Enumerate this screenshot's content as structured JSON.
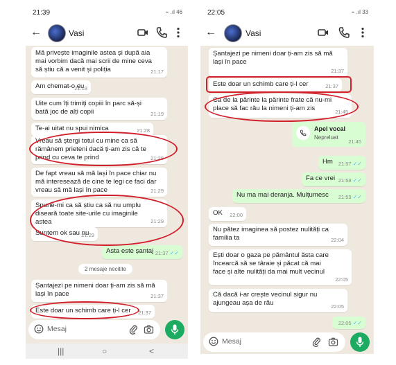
{
  "left": {
    "status_time": "21:39",
    "status_icons": "⌁ .ıl 46",
    "contact": "Vasi",
    "messages": [
      {
        "text": "Mă privește imaginile astea și după aia\nmai vorbim dacă mai scrii de mine ceva\nsă știu că a venit și poliția",
        "time": "21:17"
      },
      {
        "text": "Am chemat-o eu",
        "time": "21:18"
      },
      {
        "text": "Uite cum îți trimiți copiii în parc să-și\nbată joc de alți copii",
        "time": "21:19"
      },
      {
        "text": "Te-ai uitat nu spui nimica",
        "time": "21:28"
      },
      {
        "text": "Vreau să ștergi totul cu mine ca să\nrămânem prieteni dacă ți-am zis că te\nprind cu ceva te prind",
        "time": "21:28"
      },
      {
        "text": "De fapt vreau să mă lași în pace chiar nu\nmă interesează de cine te legi ce faci dar\nvreau să mă lași în pace",
        "time": "21:29"
      },
      {
        "text": "Spune-mi ca să știu ca să nu umplu\ndiseară toate site-urile cu imaginile\nastea",
        "time": "21:29"
      },
      {
        "text": "Suntem ok sau nu",
        "time": "21:29"
      },
      {
        "text": "Asta este șantaj",
        "time": "21:37"
      },
      {
        "text": "Șantajezi pe nimeni doar ți-am zis să mă\nlași în pace",
        "time": "21:37"
      },
      {
        "text": "Este doar un schimb care ți-l cer",
        "time": "21:37"
      }
    ],
    "unread": "2 mesaje necitite",
    "composer_placeholder": "Mesaj",
    "nav": {
      "recents": "|||",
      "home": "○",
      "back": "<"
    }
  },
  "right": {
    "status_time": "22:05",
    "status_icons": "⌁ .ıl 33",
    "contact": "Vasi",
    "messages": [
      {
        "text": "Șantajezi pe nimeni doar ți-am zis să mă\nlași în pace",
        "time": "21:37"
      },
      {
        "text": "Este doar un schimb care ți-l cer",
        "time": "21:37"
      },
      {
        "text": "Ca de la părinte la părinte frate că nu-mi\nplace să fac rău la nimeni ți-am zis",
        "time": "21:45"
      },
      {
        "text": "Hm",
        "time": "21:57"
      },
      {
        "text": "Fa ce vrei",
        "time": "21:58"
      },
      {
        "text": "Nu ma mai deranja. Mulțumesc",
        "time": "21:59"
      },
      {
        "text": "OK",
        "time": "22:00"
      },
      {
        "text": "Nu pătez imaginea să postez nulități ca\nfamilia ta",
        "time": "22:04"
      },
      {
        "text": "Ești doar o gaza pe pământul ăsta care\nîncearcă să se târaie și păcat că mai\nface și alte nulități da mai mult vecinul",
        "time": "22:05"
      },
      {
        "text": "Că dacă i-ar crește vecinul sigur nu\najungeau așa de rău",
        "time": "22:05"
      },
      {
        "text": "",
        "time": "22:05"
      }
    ],
    "call": {
      "title": "Apel vocal",
      "subtitle": "Nepreluat",
      "time": "21:45"
    },
    "composer_placeholder": "Mesaj"
  },
  "colors": {
    "chat_bg": "#efe8df",
    "outgoing": "#d9fdd3",
    "incoming": "#ffffff",
    "mic": "#1daa61",
    "highlight": "#d1202c",
    "read_tick": "#53bdeb"
  }
}
